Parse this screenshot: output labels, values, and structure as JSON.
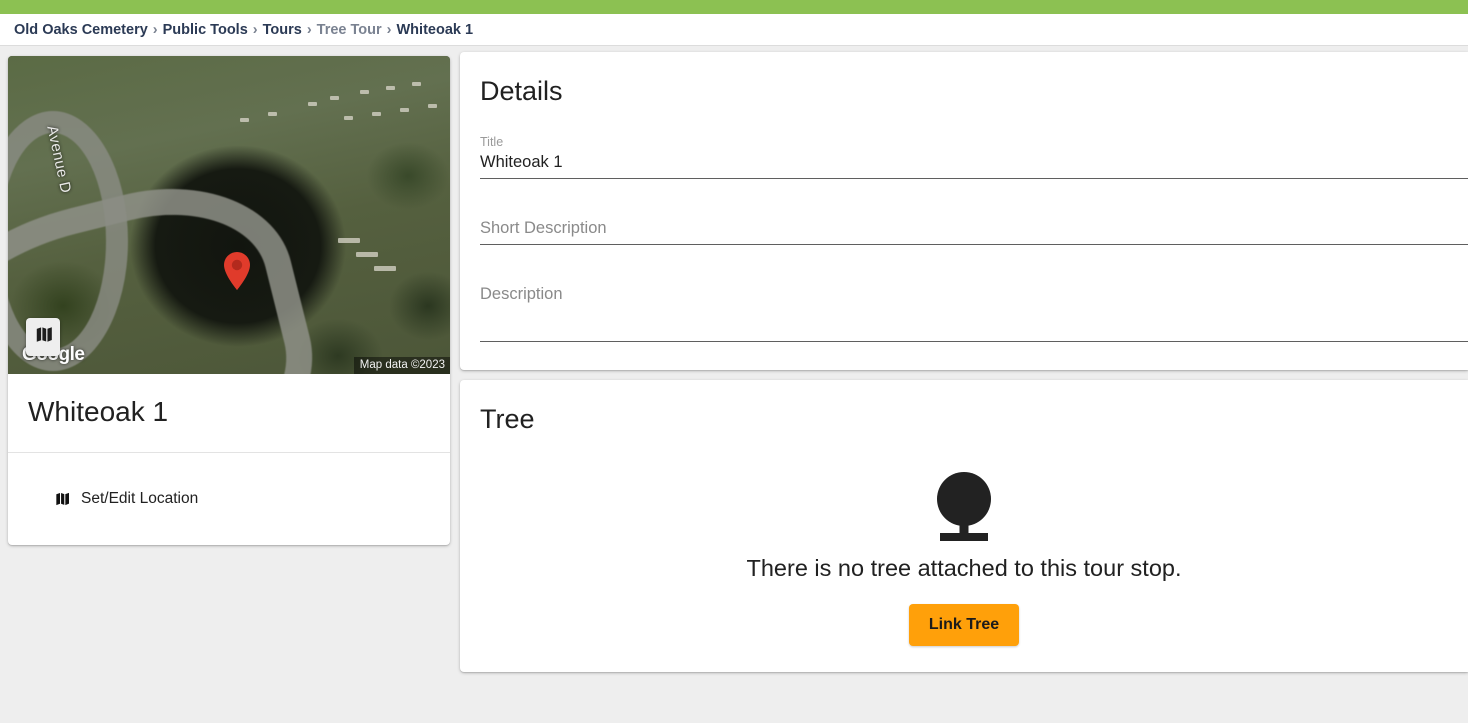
{
  "theme": {
    "accent_green": "#8cc152",
    "button_orange": "#ffa00a",
    "background": "#eeeeee",
    "breadcrumb_link": "#2b3a55",
    "breadcrumb_muted": "#7a8291"
  },
  "breadcrumb": {
    "separator": "›",
    "items": [
      {
        "label": "Old Oaks Cemetery",
        "muted": false
      },
      {
        "label": "Public Tools",
        "muted": false
      },
      {
        "label": "Tours",
        "muted": false
      },
      {
        "label": "Tree Tour",
        "muted": true
      },
      {
        "label": "Whiteoak 1",
        "muted": false
      }
    ]
  },
  "map_card": {
    "map": {
      "street_label": "Avenue D",
      "google_watermark": "Google",
      "attribution": "Map data ©2023",
      "marker_icon": "map-pin-icon",
      "layer_toggle_icon": "map-icon"
    },
    "title": "Whiteoak 1",
    "actions": [
      {
        "icon": "map-icon",
        "label": "Set/Edit Location"
      }
    ]
  },
  "details_panel": {
    "heading": "Details",
    "fields": [
      {
        "name": "title",
        "label": "Title",
        "value": "Whiteoak 1",
        "placeholder": ""
      },
      {
        "name": "short_description",
        "label": "",
        "value": "",
        "placeholder": "Short Description"
      },
      {
        "name": "description",
        "label": "",
        "value": "",
        "placeholder": "Description"
      }
    ]
  },
  "tree_panel": {
    "heading": "Tree",
    "empty_state": {
      "icon": "tree-icon",
      "message": "There is no tree attached to this tour stop.",
      "button_label": "Link Tree"
    }
  }
}
